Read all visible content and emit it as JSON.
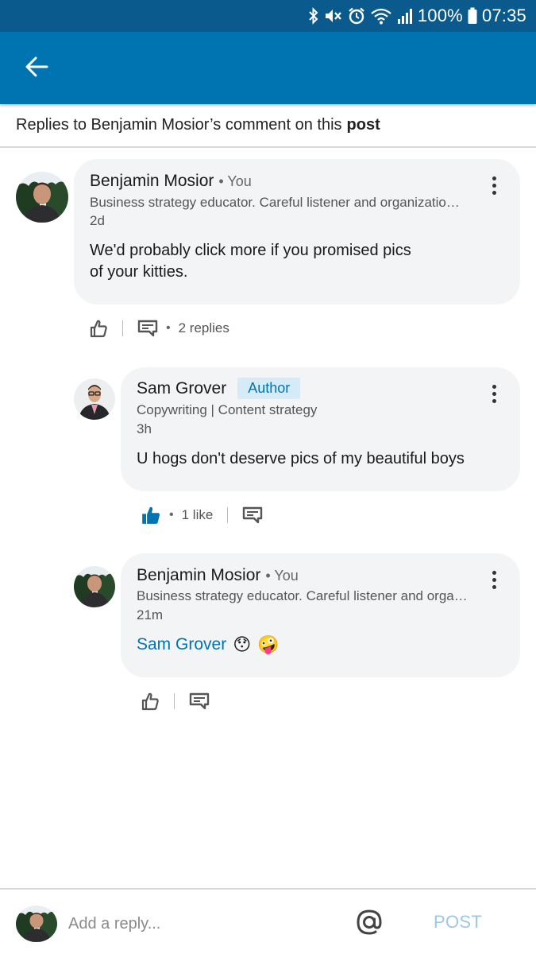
{
  "status_bar": {
    "battery": "100%",
    "time": "07:35"
  },
  "header": {
    "prefix": "Replies to Benjamin Mosior’s comment on this",
    "link": "post"
  },
  "comment": {
    "name": "Benjamin Mosior",
    "tag": "• You",
    "headline": "Business strategy educator. Careful listener and organizatio…",
    "time": "2d",
    "text_line1": "We'd probably click more if you promised pics",
    "text_line2": "of your kitties.",
    "replies": "2 replies"
  },
  "replies": [
    {
      "name": "Sam Grover",
      "badge": "Author",
      "headline": "Copywriting | Content strategy",
      "time": "3h",
      "text": "U hogs don't deserve pics of my beautiful boys",
      "likes": "1 like"
    },
    {
      "name": "Benjamin Mosior",
      "tag": "• You",
      "headline": "Business strategy educator. Careful listener and orga…",
      "time": "21m",
      "mention": "Sam Grover",
      "emoji1": "😯",
      "emoji2": "🤪"
    }
  ],
  "reply_bar": {
    "placeholder": "Add a reply...",
    "post_label": "POST"
  },
  "colors": {
    "brand": "#0073b1",
    "status_bar": "#0b5a8e",
    "bubble": "#f2f4f6",
    "post_disabled": "#9fc6e2"
  },
  "icons": [
    "back-arrow-icon",
    "bluetooth-icon",
    "mute-icon",
    "alarm-icon",
    "wifi-icon",
    "signal-icon",
    "battery-icon",
    "more-icon",
    "like-icon",
    "liked-icon",
    "reply-icon",
    "at-sign-icon"
  ]
}
